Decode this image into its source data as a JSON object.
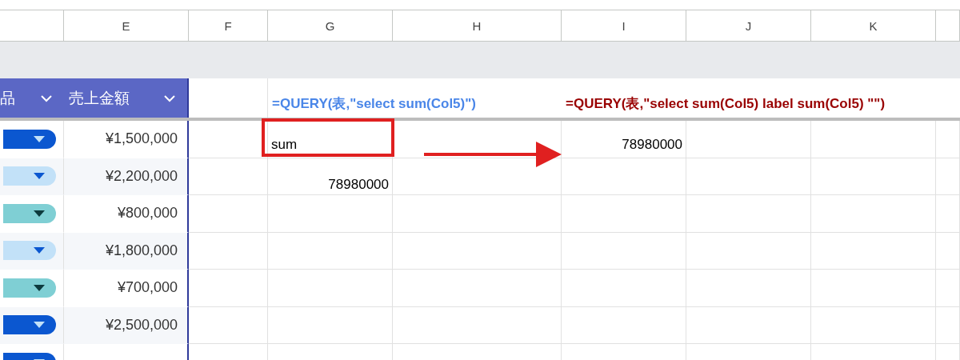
{
  "column_headers": [
    "E",
    "F",
    "G",
    "H",
    "I",
    "J",
    "K"
  ],
  "table_header": [
    {
      "label": "品"
    },
    {
      "label": "売上金額"
    }
  ],
  "formulas": [
    {
      "text": "=QUERY(表,\"select sum(Col5)\")",
      "color": "#4a86e8"
    },
    {
      "text": "=QUERY(表,\"select sum(Col5) label sum(Col5) \"\")",
      "color": "#990000"
    }
  ],
  "rows": [
    {
      "chip": {
        "color": "#0b57d0"
      },
      "amount": "¥1,500,000",
      "g_cell": {
        "text": "sum",
        "kind": "text"
      },
      "i_cell": {
        "text": "78980000",
        "kind": "number"
      }
    },
    {
      "chip": {
        "color": "#c2e1f8"
      },
      "amount": "¥2,200,000",
      "g_cell": {
        "text": "78980000",
        "kind": "number"
      }
    },
    {
      "chip": {
        "color": "#7fcfd4"
      },
      "amount": "¥800,000"
    },
    {
      "chip": {
        "color": "#c2e1f8"
      },
      "amount": "¥1,800,000"
    },
    {
      "chip": {
        "color": "#7fcfd4"
      },
      "amount": "¥700,000"
    },
    {
      "chip": {
        "color": "#0b57d0"
      },
      "amount": "¥2,500,000"
    },
    {
      "chip": {
        "color": "#0b57d0"
      }
    }
  ]
}
